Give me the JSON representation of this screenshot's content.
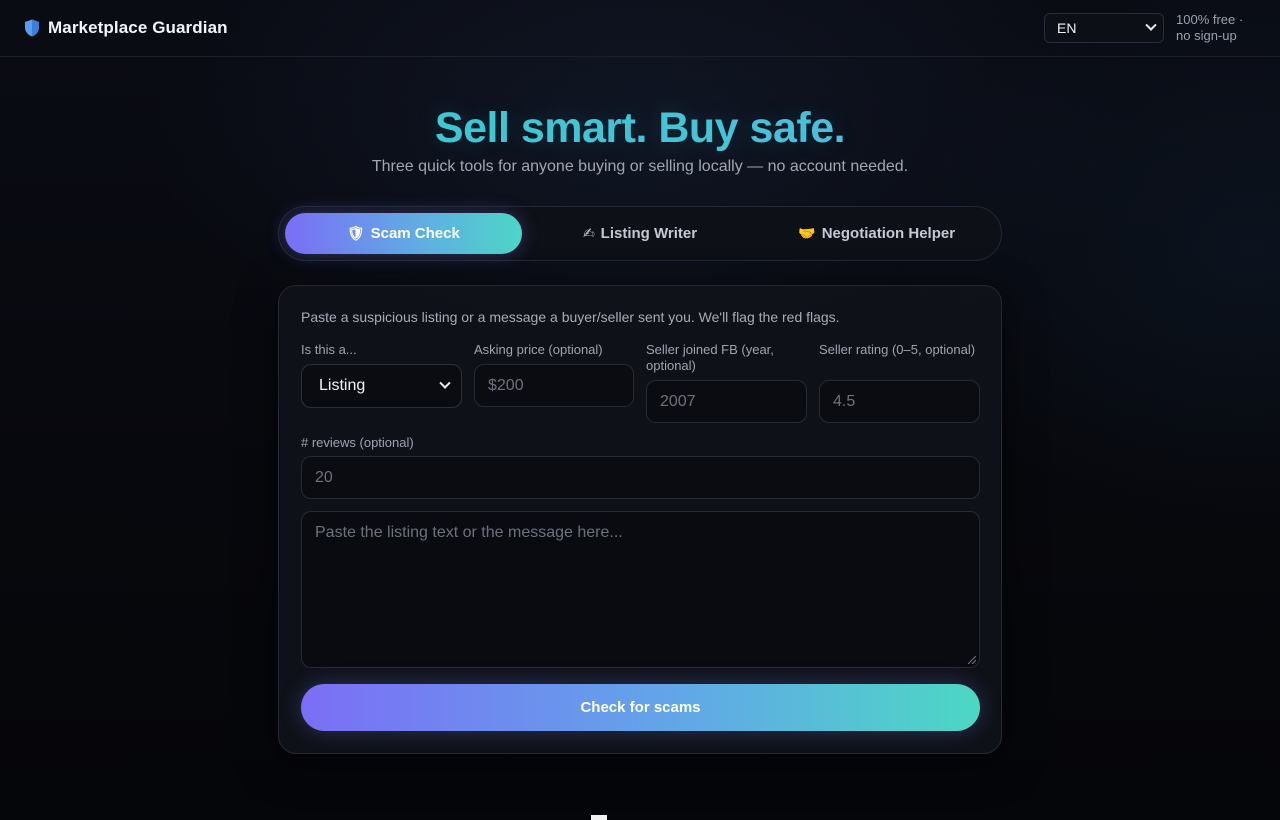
{
  "header": {
    "brand": "Marketplace Guardian",
    "brand_icon": "shield-icon",
    "language": {
      "selected": "EN"
    },
    "tagline": "100% free · no sign-up"
  },
  "hero": {
    "title": "Sell smart. Buy safe.",
    "subtitle": "Three quick tools for anyone buying or selling locally — no account needed."
  },
  "tabs": [
    {
      "label": "Scam Check",
      "icon": "🛡",
      "icon_name": "shield-icon",
      "active": true
    },
    {
      "label": "Listing Writer",
      "icon": "✍",
      "icon_name": "writing-hand-icon",
      "active": false
    },
    {
      "label": "Negotiation Helper",
      "icon": "🤝",
      "icon_name": "handshake-icon",
      "active": false
    }
  ],
  "form": {
    "intro": "Paste a suspicious listing or a message a buyer/seller sent you. We'll flag the red flags.",
    "type_label": "Is this a...",
    "type_value": "Listing",
    "price_label": "Asking price (optional)",
    "price_placeholder": "$200",
    "joined_label": "Seller joined FB (year, optional)",
    "joined_placeholder": "2007",
    "rating_label": "Seller rating (0–5, optional)",
    "rating_placeholder": "4.5",
    "reviews_label": "# reviews (optional)",
    "reviews_placeholder": "20",
    "text_placeholder": "Paste the listing text or the message here...",
    "submit": "Check for scams"
  },
  "colors": {
    "accent_start": "#7b6ef6",
    "accent_end": "#4cd8c4",
    "background": "#07080d"
  }
}
